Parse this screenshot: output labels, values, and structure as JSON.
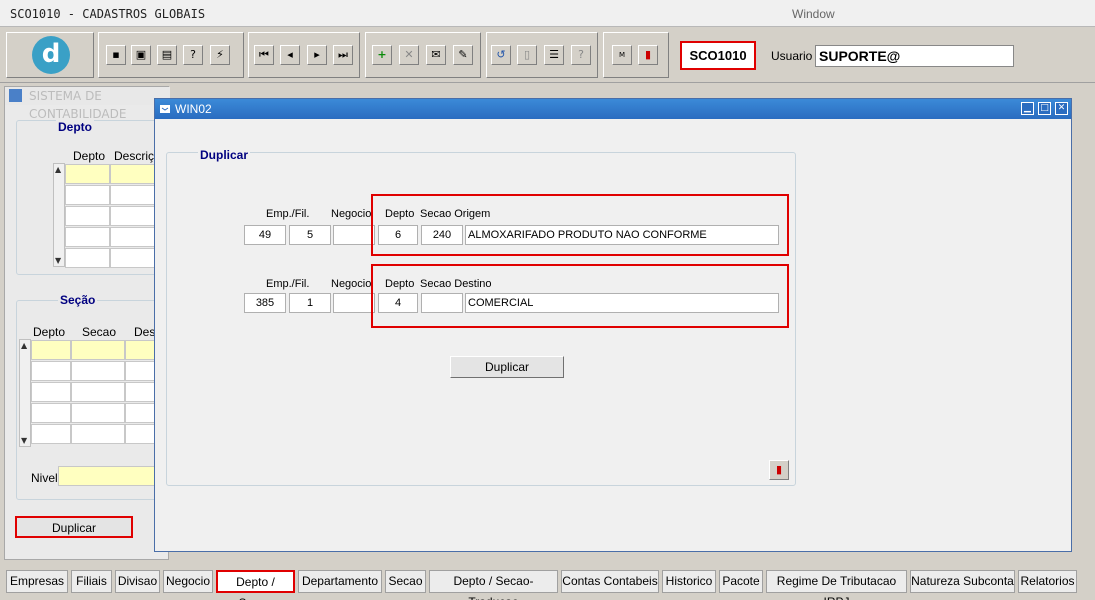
{
  "app": {
    "title": "SCO1010 - CADASTROS GLOBAIS",
    "menu_window": "Window"
  },
  "toolbar": {
    "form_code": "SCO1010",
    "usuario_label": "Usuario",
    "usuario_value": "SUPORTE@",
    "icons": [
      "save-icon",
      "print-preview-icon",
      "print-icon",
      "help-query-icon",
      "execute-query-icon",
      "first-record-icon",
      "previous-record-icon",
      "next-record-icon",
      "last-record-icon",
      "insert-record-icon",
      "delete-record-icon",
      "clear-record-icon",
      "edit-icon",
      "undo-icon",
      "clipboard-icon",
      "lov-icon",
      "help-icon",
      "menu-icon",
      "exit-icon"
    ]
  },
  "bg_window": {
    "title": "SISTEMA DE CONTABILIDADE",
    "depto_section": {
      "title": "Depto",
      "col_depto": "Depto",
      "col_descricao": "Descriç"
    },
    "secao_section": {
      "title": "Seção",
      "col_depto": "Depto",
      "col_secao": "Secao",
      "col_desc": "Des"
    },
    "nivel_label": "Nivel",
    "duplicar_button": "Duplicar"
  },
  "win02": {
    "title": "WIN02",
    "section_title": "Duplicar",
    "origem": {
      "label_emp": "Emp./Fil.",
      "label_negocio": "Negocio",
      "label_depto": "Depto",
      "label_secao": "Secao Origem",
      "empresa": "49",
      "filial": "5",
      "negocio": "",
      "depto": "6",
      "secao": "240",
      "descricao": "ALMOXARIFADO PRODUTO NAO CONFORME"
    },
    "destino": {
      "label_emp": "Emp./Fil.",
      "label_negocio": "Negocio",
      "label_depto": "Depto",
      "label_secao": "Secao Destino",
      "empresa": "385",
      "filial": "1",
      "negocio": "",
      "depto": "4",
      "secao": "",
      "descricao": "COMERCIAL"
    },
    "duplicar_button": "Duplicar"
  },
  "tabs": [
    "Empresas",
    "Filiais",
    "Divisao",
    "Negocio",
    "Depto / Secao",
    "Departamento",
    "Secao",
    "Depto / Secao-Traducao",
    "Contas Contabeis",
    "Historico",
    "Pacote",
    "Regime De Tributacao IRPJ",
    "Natureza Subconta",
    "Relatorios"
  ],
  "active_tab": "Depto / Secao",
  "colors": {
    "highlight_box": "#e00000",
    "title_blue": "#2a6cc0",
    "selected_cell": "#ffffc0",
    "section_label": "#000080"
  }
}
